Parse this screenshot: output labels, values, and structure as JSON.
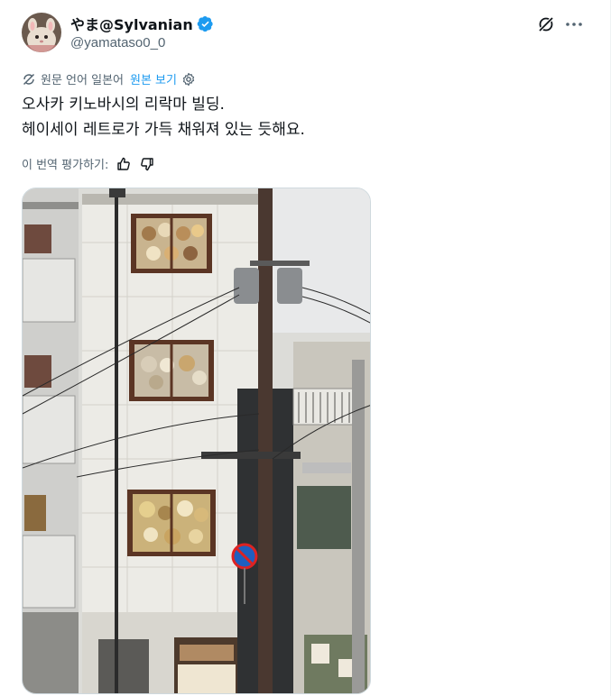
{
  "author": {
    "display_name": "やま@Sylvanian",
    "handle": "@yamataso0_0"
  },
  "translation": {
    "source_label": "원문 언어 일본어",
    "show_original_label": "원본 보기"
  },
  "post": {
    "lines": [
      "오사카 키노바시의 리락마 빌딩.",
      "헤이세이 레트로가 가득 채워져 있는 듯해요."
    ]
  },
  "rating": {
    "label": "이 번역 평가하기:"
  },
  "icons": {
    "verified": "verified-badge-icon",
    "grok": "grok-icon",
    "more": "more-dots-icon",
    "translate": "translate-icon",
    "settings": "gear-icon",
    "thumbs_up": "thumbs-up-icon",
    "thumbs_down": "thumbs-down-icon"
  },
  "colors": {
    "accent": "#1d9bf0",
    "text": "#0f1419",
    "secondary": "#536471"
  }
}
